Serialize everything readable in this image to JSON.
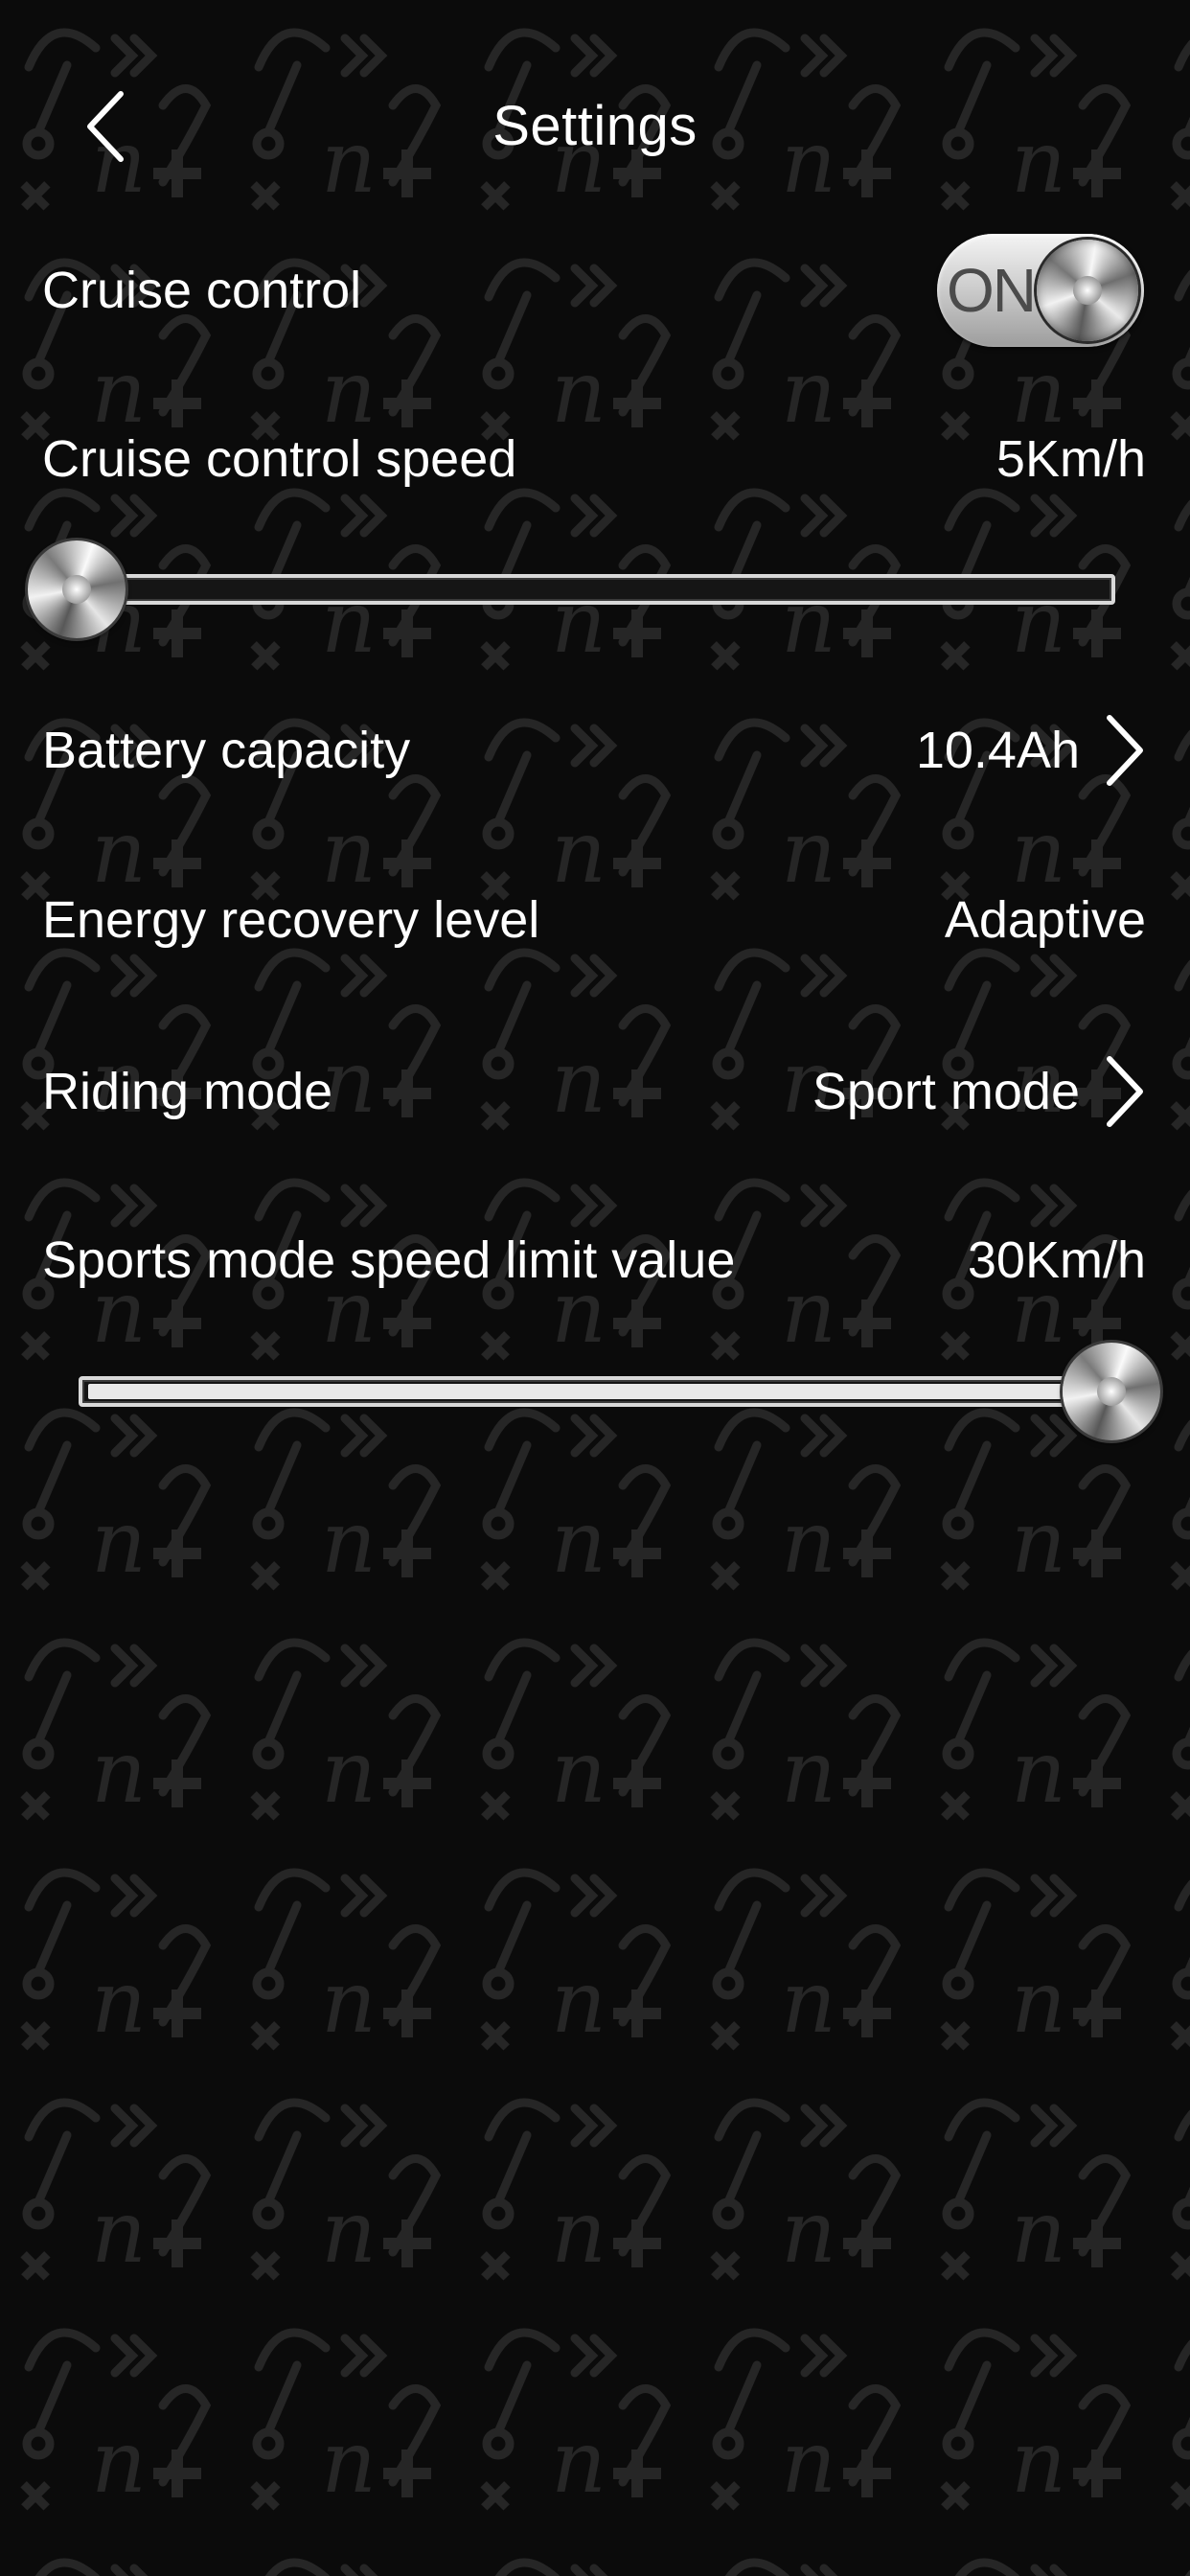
{
  "header": {
    "title": "Settings",
    "back_icon": "chevron-left-icon"
  },
  "cruise_control": {
    "label": "Cruise control",
    "toggle_text": "ON",
    "enabled": true
  },
  "cruise_speed": {
    "label": "Cruise control speed",
    "value": "5Km/h",
    "slider_level": 0.0
  },
  "battery": {
    "label": "Battery capacity",
    "value": "10.4Ah",
    "icon": "chevron-right-icon"
  },
  "energy_recovery": {
    "label": "Energy recovery level",
    "value": "Adaptive"
  },
  "riding_mode": {
    "label": "Riding mode",
    "value": "Sport mode",
    "icon": "chevron-right-icon"
  },
  "sport_limit": {
    "label": "Sports mode speed limit value",
    "value": "30Km/h",
    "slider_level": 1.0
  },
  "colors": {
    "background": "#0b0b0b",
    "pattern": "#2a2a2a",
    "text": "#ffffff",
    "toggle": "#cfcfcf"
  }
}
